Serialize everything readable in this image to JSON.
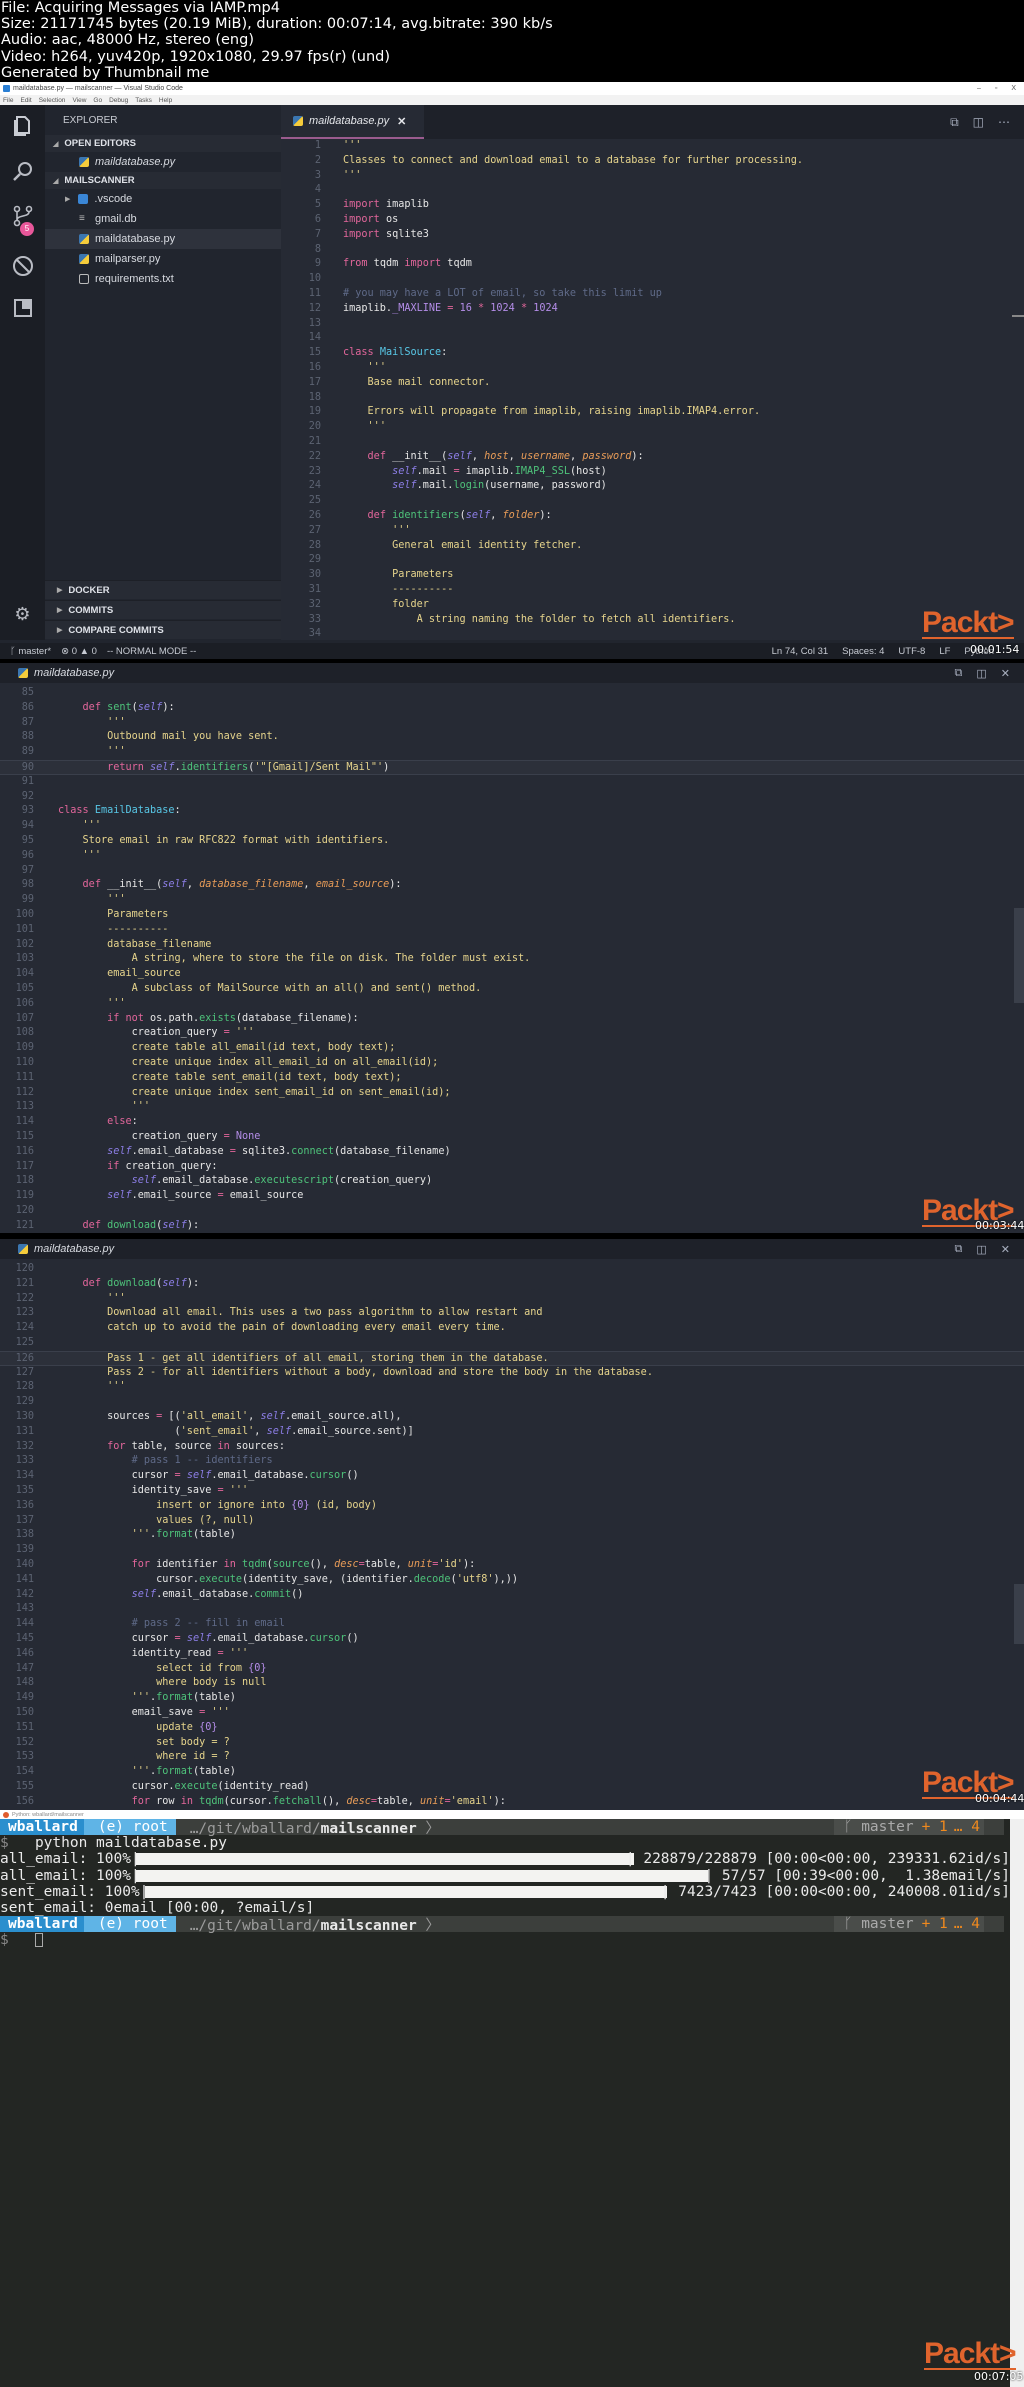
{
  "meta": {
    "file": "File: Acquiring Messages via IAMP.mp4",
    "size": "Size: 21171745 bytes (20.19 MiB), duration: 00:07:14, avg.bitrate: 390 kb/s",
    "audio": "Audio: aac, 48000 Hz, stereo (eng)",
    "video": "Video: h264, yuv420p, 1920x1080, 29.97 fps(r) (und)",
    "generator": "Generated by Thumbnail me"
  },
  "window": {
    "title": "maildatabase.py — mailscanner — Visual Studio Code",
    "menu": [
      "File",
      "Edit",
      "Selection",
      "View",
      "Go",
      "Debug",
      "Tasks",
      "Help"
    ],
    "controls": {
      "minimize": "–",
      "maximize": "▫",
      "close": "X"
    }
  },
  "activity_bar": {
    "icons": [
      "files-icon",
      "search-icon",
      "source-control-icon",
      "debug-icon",
      "extensions-icon",
      "gear-icon"
    ],
    "scm_badge": "5"
  },
  "sidebar": {
    "title": "EXPLORER",
    "open_editors_label": "OPEN EDITORS",
    "open_editors": [
      {
        "name": "maildatabase.py"
      }
    ],
    "project_label": "MAILSCANNER",
    "files": [
      {
        "name": ".vscode",
        "type": "folder"
      },
      {
        "name": "gmail.db",
        "type": "db"
      },
      {
        "name": "maildatabase.py",
        "type": "py",
        "selected": true
      },
      {
        "name": "mailparser.py",
        "type": "py"
      },
      {
        "name": "requirements.txt",
        "type": "txt"
      }
    ],
    "bottom_sections": [
      "DOCKER",
      "COMMITS",
      "COMPARE COMMITS"
    ]
  },
  "editor": {
    "tab_label": "maildatabase.py",
    "tab_close": "✕",
    "actions": [
      "open-preview-icon",
      "split-editor-icon",
      "more-icon"
    ]
  },
  "statusbar": {
    "branch": "master*",
    "errors": "0",
    "warnings": "0",
    "mode": "-- NORMAL MODE --",
    "position": "Ln 74, Col 31",
    "spaces": "Spaces: 4",
    "encoding": "UTF-8",
    "eol": "LF",
    "language": "Python"
  },
  "panel1_code": [
    {
      "n": "1",
      "h": "<span class='s'>'''</span>"
    },
    {
      "n": "2",
      "h": "<span class='s'>Classes to connect and download email to a database for further processing.</span>"
    },
    {
      "n": "3",
      "h": "<span class='s'>'''</span>"
    },
    {
      "n": "4",
      "h": ""
    },
    {
      "n": "5",
      "h": "<span class='k'>import</span> imaplib"
    },
    {
      "n": "6",
      "h": "<span class='k'>import</span> os"
    },
    {
      "n": "7",
      "h": "<span class='k'>import</span> sqlite3"
    },
    {
      "n": "8",
      "h": ""
    },
    {
      "n": "9",
      "h": "<span class='k'>from</span> tqdm <span class='k'>import</span> tqdm"
    },
    {
      "n": "10",
      "h": ""
    },
    {
      "n": "11",
      "h": "<span class='c'># you may have a LOT of email, so take this limit up</span>"
    },
    {
      "n": "12",
      "h": "imaplib.<span class='n'>_MAXLINE</span> <span class='o'>=</span> <span class='n'>16</span> <span class='o'>*</span> <span class='n'>1024</span> <span class='o'>*</span> <span class='n'>1024</span>"
    },
    {
      "n": "13",
      "h": ""
    },
    {
      "n": "14",
      "h": ""
    },
    {
      "n": "15",
      "h": "<span class='k'>class</span> <span class='cl'>MailSource</span>:"
    },
    {
      "n": "16",
      "h": "    <span class='s'>'''</span>"
    },
    {
      "n": "17",
      "h": "    <span class='s'>Base mail connector.</span>"
    },
    {
      "n": "18",
      "h": ""
    },
    {
      "n": "19",
      "h": "    <span class='s'>Errors will propagate from imaplib, raising imaplib.IMAP4.error.</span>"
    },
    {
      "n": "20",
      "h": "    <span class='s'>'''</span>"
    },
    {
      "n": "21",
      "h": ""
    },
    {
      "n": "22",
      "h": "    <span class='k'>def</span> __init__(<span class='sf'>self</span>, <span class='p'>host</span>, <span class='p'>username</span>, <span class='p'>password</span>):"
    },
    {
      "n": "23",
      "h": "        <span class='sf'>self</span>.mail <span class='o'>=</span> imaplib.<span class='f'>IMAP4_SSL</span>(host)"
    },
    {
      "n": "24",
      "h": "        <span class='sf'>self</span>.mail.<span class='f'>login</span>(username, password)"
    },
    {
      "n": "25",
      "h": ""
    },
    {
      "n": "26",
      "h": "    <span class='k'>def</span> <span class='f'>identifiers</span>(<span class='sf'>self</span>, <span class='p'>folder</span>):"
    },
    {
      "n": "27",
      "h": "        <span class='s'>'''</span>"
    },
    {
      "n": "28",
      "h": "        <span class='s'>General email identity fetcher.</span>"
    },
    {
      "n": "29",
      "h": ""
    },
    {
      "n": "30",
      "h": "        <span class='s'>Parameters</span>"
    },
    {
      "n": "31",
      "h": "        <span class='s'>----------</span>"
    },
    {
      "n": "32",
      "h": "        <span class='s'>folder</span>"
    },
    {
      "n": "33",
      "h": "            <span class='s'>A string naming the folder to fetch all identifiers.</span>"
    },
    {
      "n": "34",
      "h": ""
    }
  ],
  "panel2_code": [
    {
      "n": "85",
      "h": ""
    },
    {
      "n": "86",
      "h": "    <span class='k'>def</span> <span class='f'>sent</span>(<span class='sf'>self</span>):"
    },
    {
      "n": "87",
      "h": "        <span class='s'>'''</span>"
    },
    {
      "n": "88",
      "h": "        <span class='s'>Outbound mail you have sent.</span>"
    },
    {
      "n": "89",
      "h": "        <span class='s'>'''</span>"
    },
    {
      "n": "90",
      "h": "        <span class='k'>return</span> <span class='sf'>self</span>.<span class='f'>identifiers</span>(<span class='s'>'\"[Gmail]/Sent Mail\"'</span>)",
      "hl": true
    },
    {
      "n": "91",
      "h": ""
    },
    {
      "n": "92",
      "h": ""
    },
    {
      "n": "93",
      "h": "<span class='k'>class</span> <span class='cl'>EmailDatabase</span>:"
    },
    {
      "n": "94",
      "h": "    <span class='s'>'''</span>"
    },
    {
      "n": "95",
      "h": "    <span class='s'>Store email in raw RFC822 format with identifiers.</span>"
    },
    {
      "n": "96",
      "h": "    <span class='s'>'''</span>"
    },
    {
      "n": "97",
      "h": ""
    },
    {
      "n": "98",
      "h": "    <span class='k'>def</span> __init__(<span class='sf'>self</span>, <span class='p'>database_filename</span>, <span class='p'>email_source</span>):"
    },
    {
      "n": "99",
      "h": "        <span class='s'>'''</span>"
    },
    {
      "n": "100",
      "h": "        <span class='s'>Parameters</span>"
    },
    {
      "n": "101",
      "h": "        <span class='s'>----------</span>"
    },
    {
      "n": "102",
      "h": "        <span class='s'>database_filename</span>"
    },
    {
      "n": "103",
      "h": "            <span class='s'>A string, where to store the file on disk. The folder must exist.</span>"
    },
    {
      "n": "104",
      "h": "        <span class='s'>email_source</span>"
    },
    {
      "n": "105",
      "h": "            <span class='s'>A subclass of MailSource with an all() and sent() method.</span>"
    },
    {
      "n": "106",
      "h": "        <span class='s'>'''</span>"
    },
    {
      "n": "107",
      "h": "        <span class='k'>if</span> <span class='k'>not</span> os.path.<span class='f'>exists</span>(database_filename):"
    },
    {
      "n": "108",
      "h": "            creation_query <span class='o'>=</span> <span class='s'>'''</span>"
    },
    {
      "n": "109",
      "h": "            <span class='s'>create table all_email(id text, body text);</span>"
    },
    {
      "n": "110",
      "h": "            <span class='s'>create unique index all_email_id on all_email(id);</span>"
    },
    {
      "n": "111",
      "h": "            <span class='s'>create table sent_email(id text, body text);</span>"
    },
    {
      "n": "112",
      "h": "            <span class='s'>create unique index sent_email_id on sent_email(id);</span>"
    },
    {
      "n": "113",
      "h": "            <span class='s'>'''</span>"
    },
    {
      "n": "114",
      "h": "        <span class='k'>else</span>:"
    },
    {
      "n": "115",
      "h": "            creation_query <span class='o'>=</span> <span class='n'>None</span>"
    },
    {
      "n": "116",
      "h": "        <span class='sf'>self</span>.email_database <span class='o'>=</span> sqlite3.<span class='f'>connect</span>(database_filename)"
    },
    {
      "n": "117",
      "h": "        <span class='k'>if</span> creation_query:"
    },
    {
      "n": "118",
      "h": "            <span class='sf'>self</span>.email_database.<span class='f'>executescript</span>(creation_query)"
    },
    {
      "n": "119",
      "h": "        <span class='sf'>self</span>.email_source <span class='o'>=</span> email_source"
    },
    {
      "n": "120",
      "h": ""
    },
    {
      "n": "121",
      "h": "    <span class='k'>def</span> <span class='f'>download</span>(<span class='sf'>self</span>):"
    }
  ],
  "panel3_code": [
    {
      "n": "120",
      "h": ""
    },
    {
      "n": "121",
      "h": "    <span class='k'>def</span> <span class='f'>download</span>(<span class='sf'>self</span>):"
    },
    {
      "n": "122",
      "h": "        <span class='s'>'''</span>"
    },
    {
      "n": "123",
      "h": "        <span class='s'>Download all email. This uses a two pass algorithm to allow restart and</span>"
    },
    {
      "n": "124",
      "h": "        <span class='s'>catch up to avoid the pain of downloading every email every time.</span>"
    },
    {
      "n": "125",
      "h": ""
    },
    {
      "n": "126",
      "h": "        <span class='s'>Pass 1 - get all identifiers of all email, storing them in the database.</span>",
      "hl": true
    },
    {
      "n": "127",
      "h": "        <span class='s'>Pass 2 - for all identifiers without a body, download and store the body in the database.</span>"
    },
    {
      "n": "128",
      "h": "        <span class='s'>'''</span>"
    },
    {
      "n": "129",
      "h": ""
    },
    {
      "n": "130",
      "h": "        sources <span class='o'>=</span> [(<span class='s'>'all_email'</span>, <span class='sf'>self</span>.email_source.all),"
    },
    {
      "n": "131",
      "h": "                   (<span class='s'>'sent_email'</span>, <span class='sf'>self</span>.email_source.sent)]"
    },
    {
      "n": "132",
      "h": "        <span class='k'>for</span> table, source <span class='k'>in</span> sources:"
    },
    {
      "n": "133",
      "h": "            <span class='c'># pass 1 -- identifiers</span>"
    },
    {
      "n": "134",
      "h": "            cursor <span class='o'>=</span> <span class='sf'>self</span>.email_database.<span class='f'>cursor</span>()"
    },
    {
      "n": "135",
      "h": "            identity_save <span class='o'>=</span> <span class='s'>'''</span>"
    },
    {
      "n": "136",
      "h": "                <span class='s'>insert or ignore into </span><span class='n'>{0}</span><span class='s'> (id, body)</span>"
    },
    {
      "n": "137",
      "h": "                <span class='s'>values (?, null)</span>"
    },
    {
      "n": "138",
      "h": "            <span class='s'>'''</span>.<span class='f'>format</span>(table)"
    },
    {
      "n": "139",
      "h": ""
    },
    {
      "n": "140",
      "h": "            <span class='k'>for</span> identifier <span class='k'>in</span> <span class='f'>tqdm</span>(<span class='f'>source</span>(), <span class='p'>desc</span><span class='o'>=</span>table, <span class='p'>unit</span><span class='o'>=</span><span class='s'>'id'</span>):"
    },
    {
      "n": "141",
      "h": "                cursor.<span class='f'>execute</span>(identity_save, (identifier.<span class='f'>decode</span>(<span class='s'>'utf8'</span>),))"
    },
    {
      "n": "142",
      "h": "            <span class='sf'>self</span>.email_database.<span class='f'>commit</span>()"
    },
    {
      "n": "143",
      "h": ""
    },
    {
      "n": "144",
      "h": "            <span class='c'># pass 2 -- fill in email</span>"
    },
    {
      "n": "145",
      "h": "            cursor <span class='o'>=</span> <span class='sf'>self</span>.email_database.<span class='f'>cursor</span>()"
    },
    {
      "n": "146",
      "h": "            identity_read <span class='o'>=</span> <span class='s'>'''</span>"
    },
    {
      "n": "147",
      "h": "                <span class='s'>select id from </span><span class='n'>{0}</span>"
    },
    {
      "n": "148",
      "h": "                <span class='s'>where body is null</span>"
    },
    {
      "n": "149",
      "h": "            <span class='s'>'''</span>.<span class='f'>format</span>(table)"
    },
    {
      "n": "150",
      "h": "            email_save <span class='o'>=</span> <span class='s'>'''</span>"
    },
    {
      "n": "151",
      "h": "                <span class='s'>update </span><span class='n'>{0}</span>"
    },
    {
      "n": "152",
      "h": "                <span class='s'>set body = ?</span>"
    },
    {
      "n": "153",
      "h": "                <span class='s'>where id = ?</span>"
    },
    {
      "n": "154",
      "h": "            <span class='s'>'''</span>.<span class='f'>format</span>(table)"
    },
    {
      "n": "155",
      "h": "            cursor.<span class='f'>execute</span>(identity_read)"
    },
    {
      "n": "156",
      "h": "            <span class='k'>for</span> row <span class='k'>in</span> <span class='f'>tqdm</span>(cursor.<span class='f'>fetchall</span>(), <span class='p'>desc</span><span class='o'>=</span>table, <span class='p'>unit</span><span class='o'>=</span><span class='s'>'email'</span>):"
    }
  ],
  "watermark": {
    "brand": "Packt>",
    "timestamps": [
      "00:01:54",
      "00:03:44",
      "00:04:44",
      "00:07:05"
    ]
  },
  "terminal": {
    "title": "Python: wballard/mailscanner",
    "prompt": {
      "user": "wballard",
      "env": "(e) root",
      "path_prefix": "…/git/wballard/",
      "path_dir": "mailscanner",
      "branch": "master",
      "plus": "+ 1",
      "dots": "… 4",
      "symbol": "$"
    },
    "command": "python maildatabase.py",
    "progress": [
      {
        "label": "all_email: 100%|",
        "fraction": 1.0,
        "stats": "| 228879/228879 [00:00<00:00, 239331.62id/s]"
      },
      {
        "label": "all_email: 100%|",
        "fraction": 1.0,
        "stats": "| 57/57 [00:39<00:00,  1.38email/s]"
      },
      {
        "label": "sent_email: 100%|",
        "fraction": 1.0,
        "stats": "| 7423/7423 [00:00<00:00, 240008.01id/s]"
      }
    ],
    "last_line": "sent_email: 0email [00:00, ?email/s]"
  }
}
